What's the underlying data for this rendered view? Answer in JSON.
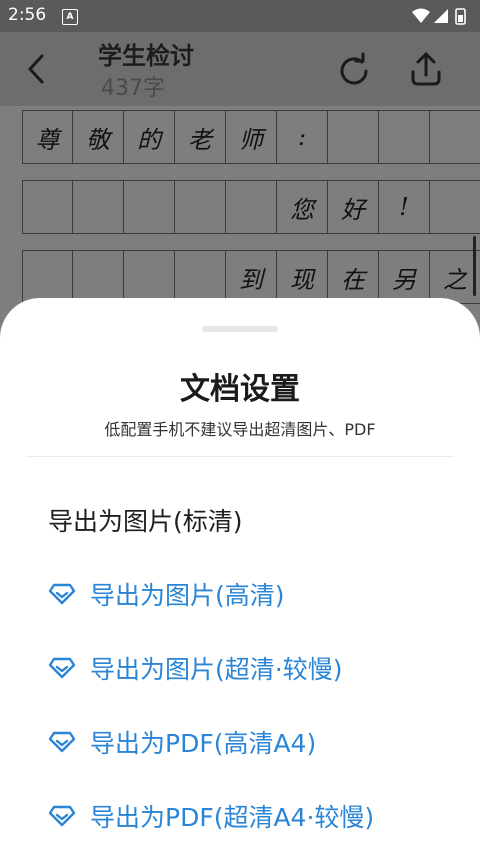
{
  "status_bar": {
    "time": "2:56",
    "notif_letter": "A"
  },
  "app_bar": {
    "title": "学生检讨",
    "word_count": "437字"
  },
  "paper": {
    "rows": [
      [
        "尊",
        "敬",
        "的",
        "老",
        "师",
        ":",
        "",
        "",
        "",
        ""
      ],
      [
        "",
        "",
        "",
        "",
        "",
        "您",
        "好",
        "!",
        "",
        ""
      ],
      [
        "",
        "",
        "",
        "",
        "到",
        "现",
        "在",
        "另",
        "之",
        ""
      ]
    ]
  },
  "sheet": {
    "title": "文档设置",
    "subtitle": "低配置手机不建议导出超清图片、PDF",
    "options": [
      {
        "label": "导出为图片(标清)",
        "premium": false
      },
      {
        "label": "导出为图片(高清)",
        "premium": true
      },
      {
        "label": "导出为图片(超清·较慢)",
        "premium": true
      },
      {
        "label": "导出为PDF(高清A4)",
        "premium": true
      },
      {
        "label": "导出为PDF(超清A4·较慢)",
        "premium": true
      }
    ]
  },
  "colors": {
    "accent": "#2a85d6",
    "overlay": "#7e7e7e"
  }
}
